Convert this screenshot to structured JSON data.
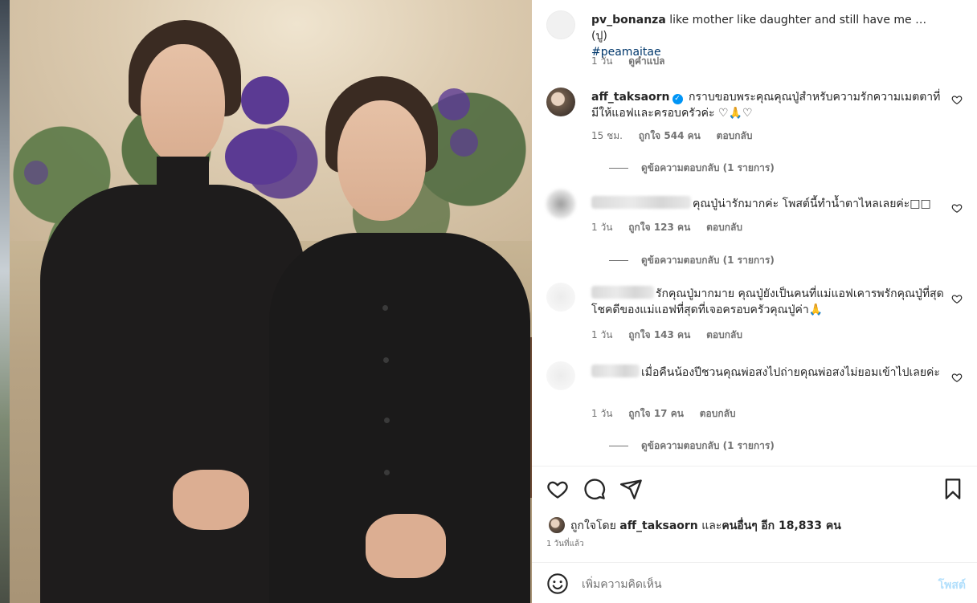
{
  "comments": [
    {
      "username": "pv_bonanza",
      "text": "like mother like daughter and still have me … (ปู)",
      "hashtag": "#peamaitae",
      "time": "1 วัน",
      "translate_label": "ดูคำแปล"
    },
    {
      "username": "aff_taksaorn",
      "verified": true,
      "text": "กราบขอบพระคุณคุณปู่สำหรับความรักความเมตตาที่มีให้แอฟและครอบครัวค่ะ ♡🙏♡",
      "time": "15 ชม.",
      "likes": "ถูกใจ 544 คน",
      "reply_label": "ตอบกลับ",
      "view_replies": "ดูข้อความตอบกลับ (1 รายการ)"
    },
    {
      "username": "",
      "text": "คุณปู่น่ารักมากค่ะ โพสต์นี้ทำน้ำตาไหลเลยค่ะ□□",
      "time": "1 วัน",
      "likes": "ถูกใจ 123 คน",
      "reply_label": "ตอบกลับ",
      "view_replies": "ดูข้อความตอบกลับ (1 รายการ)"
    },
    {
      "username": "",
      "text": "รักคุณปู่มากมาย คุณปู่ยังเป็นคนที่แม่แอฟเคารพรักคุณปู่ที่สุด โชคดีของแม่แอฟที่สุดที่เจอครอบครัวคุณปู่ค่า🙏",
      "time": "1 วัน",
      "likes": "ถูกใจ 143 คน",
      "reply_label": "ตอบกลับ"
    },
    {
      "username": "",
      "text": "เมื่อคืนน้องปีชวนคุณพ่อสงไปถ่ายคุณพ่อสงไม่ยอมเข้าไปเลยค่ะ",
      "time": "1 วัน",
      "likes": "ถูกใจ 17 คน",
      "reply_label": "ตอบกลับ",
      "view_replies": "ดูข้อความตอบกลับ (1 รายการ)"
    }
  ],
  "actions": {
    "like_icon": "heart-icon",
    "comment_icon": "comment-bubble-icon",
    "share_icon": "paper-plane-icon",
    "save_icon": "bookmark-icon"
  },
  "liked_by": {
    "prefix": "ถูกใจโดย",
    "user": "aff_taksaorn",
    "conjunction": "และ",
    "others": "คนอื่นๆ",
    "count_text": "อีก 18,833 คน"
  },
  "post_date": "1 วันที่แล้ว",
  "add_comment": {
    "emoji_icon": "smiley-icon",
    "placeholder": "เพิ่มความคิดเห็น",
    "post_label": "โพสต์"
  },
  "colors": {
    "text": "#262626",
    "secondary": "#737373",
    "link": "#00376b",
    "verified": "#0095f6",
    "post_disabled": "#b2dffc"
  }
}
